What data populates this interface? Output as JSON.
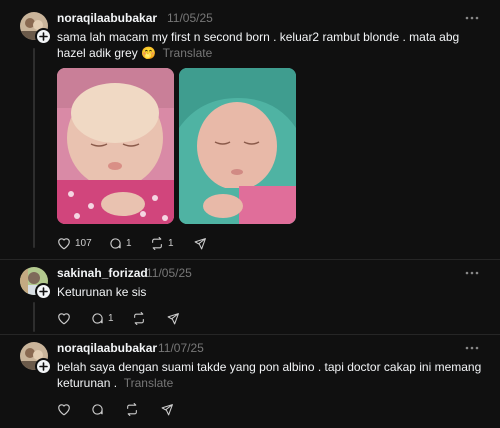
{
  "posts": [
    {
      "username": "noraqilaabubakar",
      "date": "11/05/25",
      "text": "sama lah macam my first n second born . keluar2 rambut blonde . mata abg hazel adik grey 🤭",
      "translate": "Translate",
      "likes": "107",
      "replies": "1",
      "reposts": "1",
      "images": [
        "baby-photo-1",
        "baby-photo-2"
      ]
    },
    {
      "username": "sakinah_forizad",
      "date": "11/05/25",
      "text": "Keturunan ke sis",
      "replies": "1"
    },
    {
      "username": "noraqilaabubakar",
      "date": "11/07/25",
      "text_line1": "belah saya dengan suami takde yang pon albino . tapi doctor cakap ini memang",
      "text_line2": "keturunan .",
      "translate": "Translate"
    }
  ],
  "icons": [
    "heart-icon",
    "comment-icon",
    "repost-icon",
    "share-icon",
    "more-icon",
    "follow-plus-icon"
  ],
  "colors": {
    "background": "#101010",
    "text": "#f3f5f7",
    "muted": "#777777"
  }
}
